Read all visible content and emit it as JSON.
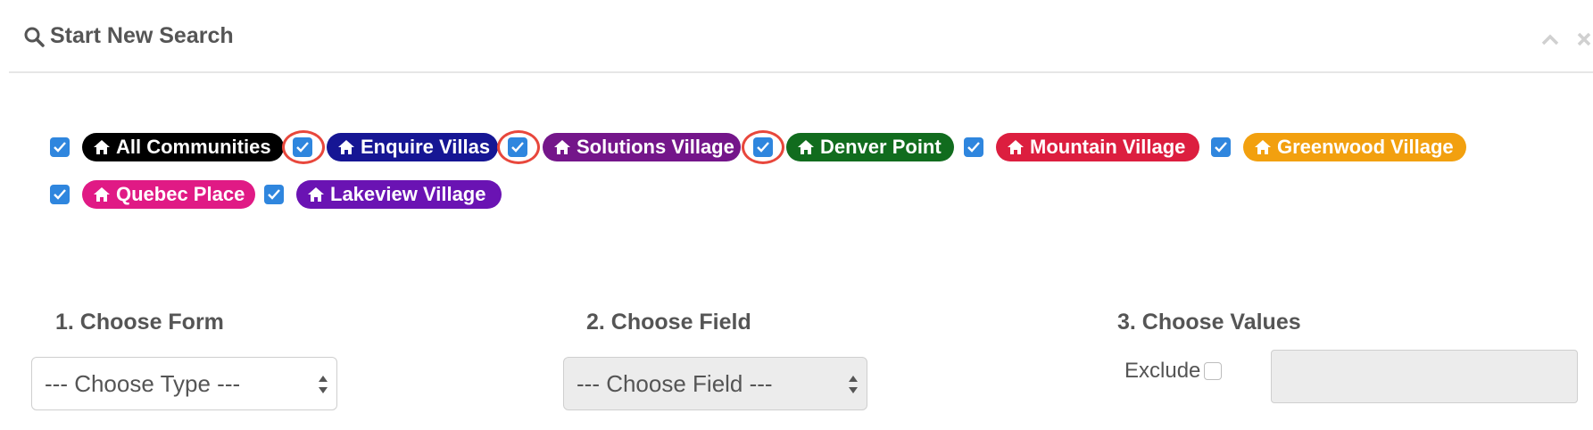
{
  "header": {
    "title": "Start New Search",
    "icons": {
      "search": "search-icon",
      "collapse": "chevron-up-icon",
      "close": "close-icon"
    }
  },
  "communities": [
    {
      "label": "All Communities",
      "color": "#000000",
      "checked": true,
      "highlighted": false
    },
    {
      "label": "Enquire Villas",
      "color": "#161694",
      "checked": true,
      "highlighted": true
    },
    {
      "label": "Solutions Village",
      "color": "#74168a",
      "checked": true,
      "highlighted": true
    },
    {
      "label": "Denver Point",
      "color": "#116c1e",
      "checked": true,
      "highlighted": true
    },
    {
      "label": "Mountain Village",
      "color": "#dc1e3f",
      "checked": true,
      "highlighted": false
    },
    {
      "label": "Greenwood Village",
      "color": "#f2a00f",
      "checked": true,
      "highlighted": false
    },
    {
      "label": "Quebec Place",
      "color": "#e01a85",
      "checked": true,
      "highlighted": false
    },
    {
      "label": "Lakeview Village",
      "color": "#6a13b3",
      "checked": true,
      "highlighted": false
    }
  ],
  "steps": {
    "form": {
      "label": "1. Choose Form",
      "value": "--- Choose Type ---"
    },
    "field": {
      "label": "2. Choose Field",
      "value": "--- Choose Field ---",
      "disabled": true
    },
    "values": {
      "label": "3. Choose Values",
      "exclude_label": "Exclude",
      "exclude_checked": false,
      "value": ""
    }
  },
  "colors": {
    "checkbox": "#2f86de",
    "highlight_ring": "#e8473c"
  }
}
